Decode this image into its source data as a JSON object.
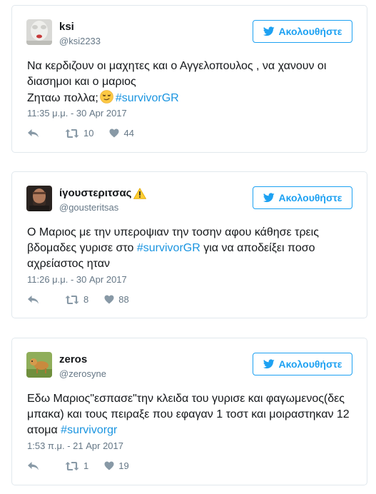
{
  "follow_label": "Ακολουθήστε",
  "accent_color": "#1da1f2",
  "hashtag_color": "#1b95e0",
  "tweets": [
    {
      "name": "ksi",
      "handle": "@ksi2233",
      "text_lines": [
        "Να κερδιζουν οι μαχητες και ο Αγγελοπουλος , να χανουν οι",
        "διασημοι και ο μαριος"
      ],
      "text_prefix": "Ζηταω πολλα;",
      "emoji": "smirking-face",
      "hashtag": "#survivorGR",
      "time": "11:35 μ.μ. - 30 Apr 2017",
      "retweets": "10",
      "likes": "44"
    },
    {
      "name": "ίγουστεριτσας",
      "badge": "warning-icon",
      "handle": "@gousteritsas",
      "text_lines": [
        "Ο Μαριος με την υπεροψιαν την τοσην αφου κάθησε τρεις"
      ],
      "text_prefix": "βδομαδες γυρισε στο",
      "hashtag": "#survivorGR",
      "text_suffix": "για να αποδείξει ποσο",
      "text_last": "αχρείαστος ηταν",
      "time": "11:26 μ.μ. - 30 Apr 2017",
      "retweets": "8",
      "likes": "88"
    },
    {
      "name": "zeros",
      "handle": "@zerosyne",
      "text_lines": [
        "Εδω Μαριος\"εσπασε\"την κλειδα του γυρισε και φαγωμενος(δες",
        "μπακα) και τους πειραξε που εφαγαν 1 τοστ και μοιραστηκαν 12"
      ],
      "text_prefix": "ατομα",
      "hashtag": "#survivorgr",
      "time": "1:53 π.μ. - 21 Apr 2017",
      "retweets": "1",
      "likes": "19"
    }
  ]
}
